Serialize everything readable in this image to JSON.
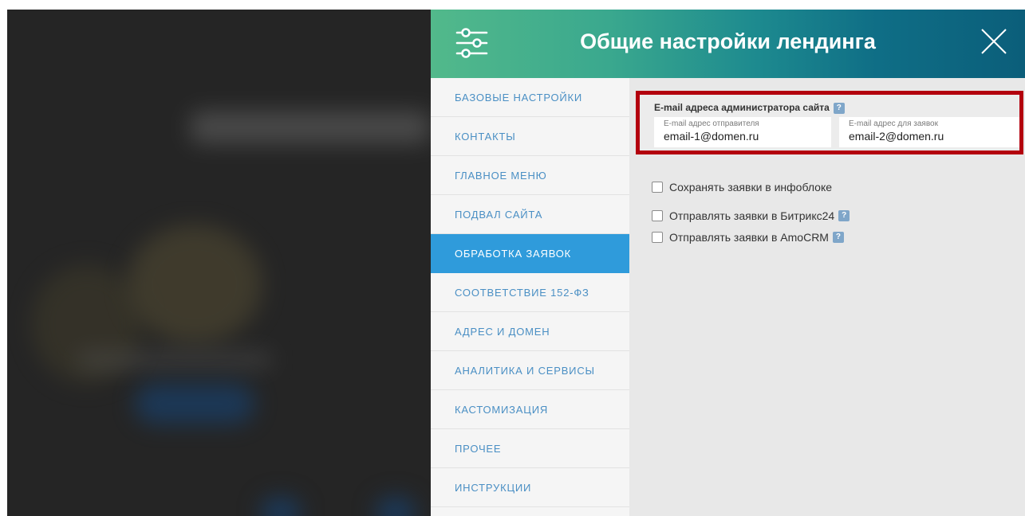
{
  "panel": {
    "title": "Общие настройки лендинга",
    "header_gradient": [
      "#52b98b",
      "#0b5e7a"
    ]
  },
  "sidebar": {
    "items": [
      {
        "label": "БАЗОВЫЕ НАСТРОЙКИ",
        "active": false
      },
      {
        "label": "КОНТАКТЫ",
        "active": false
      },
      {
        "label": "ГЛАВНОЕ МЕНЮ",
        "active": false
      },
      {
        "label": "ПОДВАЛ САЙТА",
        "active": false
      },
      {
        "label": "ОБРАБОТКА ЗАЯВОК",
        "active": true
      },
      {
        "label": "СООТВЕТСТВИЕ 152-ФЗ",
        "active": false
      },
      {
        "label": "АДРЕС И ДОМЕН",
        "active": false
      },
      {
        "label": "АНАЛИТИКА И СЕРВИСЫ",
        "active": false
      },
      {
        "label": "КАСТОМИЗАЦИЯ",
        "active": false
      },
      {
        "label": "ПРОЧЕЕ",
        "active": false
      },
      {
        "label": "ИНСТРУКЦИИ",
        "active": false
      }
    ],
    "active_color": "#2f9bdb",
    "link_color": "#4a8fc4"
  },
  "email_section": {
    "heading": "E-mail адреса администратора сайта",
    "help": "?",
    "highlight_color": "#b3000e",
    "sender": {
      "label": "E-mail адрес отправителя",
      "value": "email-1@domen.ru"
    },
    "requests": {
      "label": "E-mail адрес для заявок",
      "value": "email-2@domen.ru"
    }
  },
  "options": [
    {
      "label": "Сохранять заявки в инфоблоке",
      "checked": false,
      "help": ""
    },
    {
      "label": "Отправлять заявки в Битрикс24",
      "checked": false,
      "help": "?"
    },
    {
      "label": "Отправлять заявки в AmoCRM",
      "checked": false,
      "help": "?"
    }
  ]
}
